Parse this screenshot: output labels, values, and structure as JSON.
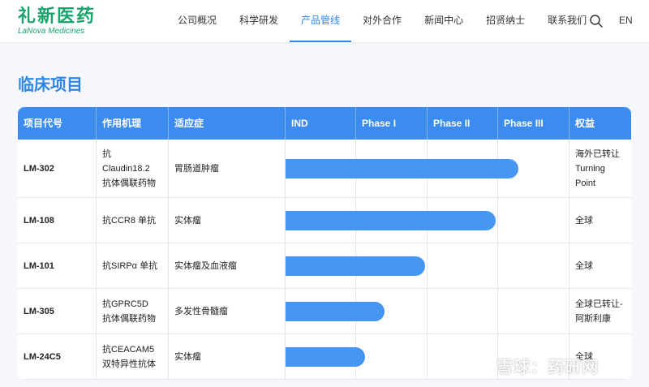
{
  "brand": {
    "name_cn": "礼新医药",
    "name_en": "LaNova Medicines"
  },
  "nav": {
    "items": [
      {
        "label": "公司概况",
        "active": false
      },
      {
        "label": "科学研发",
        "active": false
      },
      {
        "label": "产品管线",
        "active": true
      },
      {
        "label": "对外合作",
        "active": false
      },
      {
        "label": "新闻中心",
        "active": false
      },
      {
        "label": "招贤纳士",
        "active": false
      },
      {
        "label": "联系我们",
        "active": false
      }
    ],
    "lang": "EN"
  },
  "page": {
    "title": "临床项目"
  },
  "table": {
    "headers": [
      "项目代号",
      "作用机理",
      "适应症",
      "IND",
      "Phase I",
      "Phase II",
      "Phase III",
      "权益"
    ],
    "rows": [
      {
        "code": "LM-302",
        "mechanism": [
          "抗",
          "Claudin18.2",
          "抗体偶联药物"
        ],
        "indication": "胃肠道肿瘤",
        "rights": [
          "海外已转让",
          "Turning",
          "Point"
        ],
        "progress": 0.82
      },
      {
        "code": "LM-108",
        "mechanism": [
          "抗CCR8 单抗"
        ],
        "indication": "实体瘤",
        "rights": [
          "全球"
        ],
        "progress": 0.74
      },
      {
        "code": "LM-101",
        "mechanism": [
          "抗SIRPα 单抗"
        ],
        "indication": "实体瘤及血液瘤",
        "rights": [
          "全球"
        ],
        "progress": 0.49
      },
      {
        "code": "LM-305",
        "mechanism": [
          "抗GPRC5D",
          "抗体偶联药物"
        ],
        "indication": "多发性骨髓瘤",
        "rights": [
          "全球已转让-",
          "阿斯利康"
        ],
        "progress": 0.35
      },
      {
        "code": "LM-24C5",
        "mechanism": [
          "抗CEACAM5",
          "双特异性抗体"
        ],
        "indication": "实体瘤",
        "rights": [
          "全球"
        ],
        "progress": 0.28
      }
    ]
  },
  "watermark": "雪球：药研网",
  "colors": {
    "accent": "#2f86e9",
    "header_bg": "#3c8cf0",
    "bar": "#4596f3",
    "logo": "#1aa36b"
  }
}
